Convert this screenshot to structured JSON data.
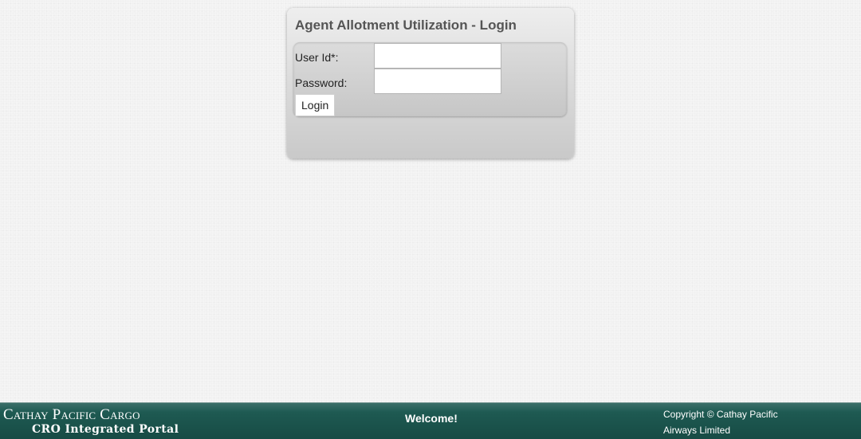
{
  "login": {
    "title": "Agent Allotment Utilization - Login",
    "userid_label": "User Id*:",
    "userid_value": "",
    "password_label": "Password:",
    "password_value": "",
    "login_button": "Login"
  },
  "footer": {
    "brand": "Cathay Pacific Cargo",
    "portal": "CRO Integrated Portal",
    "welcome": "Welcome!",
    "copyright": "Copyright © Cathay Pacific Airways Limited"
  },
  "colors": {
    "footer_bg": "#1e5a52",
    "panel_title": "#555555"
  }
}
